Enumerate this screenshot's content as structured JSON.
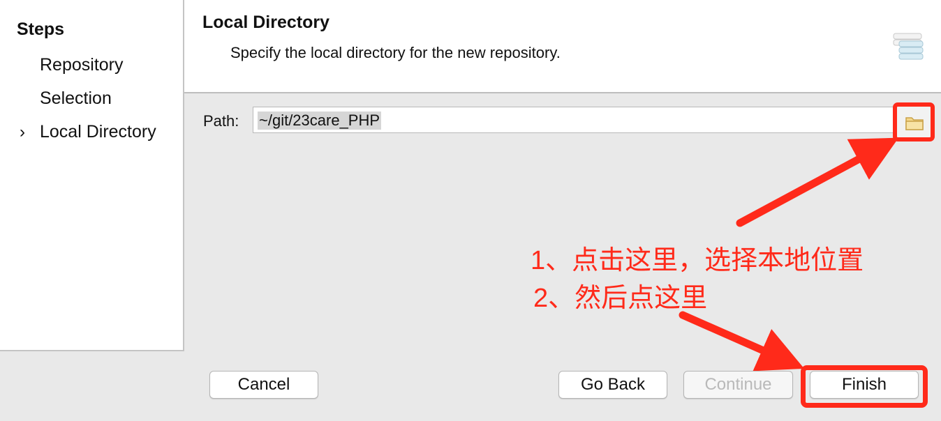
{
  "steps": {
    "title": "Steps",
    "items": [
      {
        "label": "Repository",
        "current": false
      },
      {
        "label": "Selection",
        "current": false
      },
      {
        "label": "Local Directory",
        "current": true
      }
    ],
    "current_marker": "›"
  },
  "header": {
    "title": "Local Directory",
    "description": "Specify the local directory for the new repository.",
    "icon": "database-icon"
  },
  "path": {
    "label": "Path:",
    "value": "~/git/23care_PHP",
    "browse_icon": "folder-icon"
  },
  "annotations": {
    "line1": "1、点击这里，选择本地位置",
    "line2": "2、然后点这里",
    "color": "#ff2a1a"
  },
  "buttons": {
    "cancel": "Cancel",
    "back": "Go Back",
    "continue": "Continue",
    "finish": "Finish"
  }
}
